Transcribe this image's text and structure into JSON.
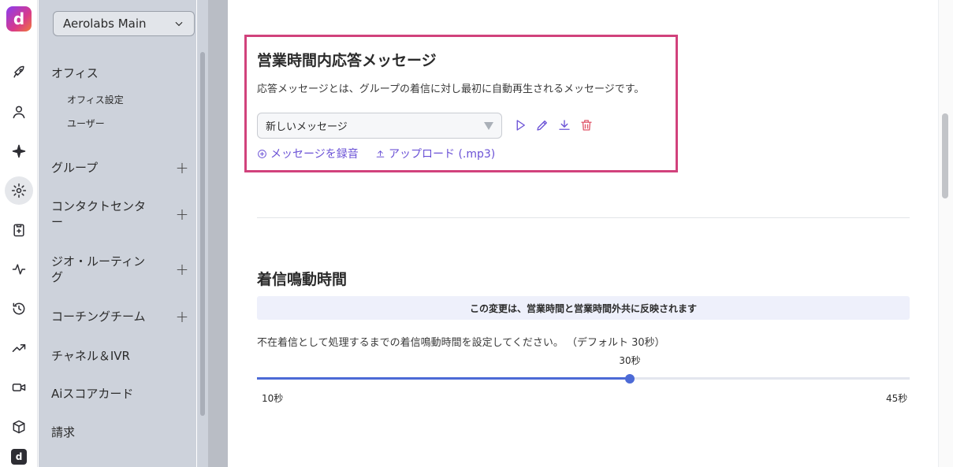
{
  "rail": {
    "logo_letter": "d",
    "icons": [
      "rocket-icon",
      "user-icon",
      "sparkle-icon",
      "gear-icon",
      "clipboard-icon",
      "activity-icon",
      "history-icon",
      "trending-icon",
      "video-icon",
      "cube-icon"
    ],
    "bottom_letter": "d"
  },
  "sidebar": {
    "org_name": "Aerolabs Main",
    "office": "オフィス",
    "office_settings": "オフィス設定",
    "users": "ユーザー",
    "groups": "グループ",
    "contact_center": "コンタクトセンター",
    "geo_routing": "ジオ・ルーティング",
    "coaching_team": "コーチングチーム",
    "channel_ivr": "チャネル＆IVR",
    "ai_scorecard": "Aiスコアカード",
    "billing": "請求",
    "plus": "+"
  },
  "business_hours_message": {
    "title": "営業時間内応答メッセージ",
    "description": "応答メッセージとは、グループの着信に対し最初に自動再生されるメッセージです。",
    "selected_message": "新しいメッセージ",
    "record_link": "メッセージを録音",
    "upload_link": "アップロード (.mp3)"
  },
  "ring_duration": {
    "title": "着信鳴動時間",
    "notice": "この変更は、営業時間と営業時間外共に反映されます",
    "description": "不在着信として処理するまでの着信鳴動時間を設定してください。 （デフォルト 30秒）",
    "value_label": "30秒",
    "value": 30,
    "min": 10,
    "max": 45,
    "min_label": "10秒",
    "max_label": "45秒"
  },
  "colors": {
    "accent": "#6b52d6",
    "slider": "#4c6ad6",
    "highlight_border": "#d1427c",
    "delete": "#e0576a"
  }
}
